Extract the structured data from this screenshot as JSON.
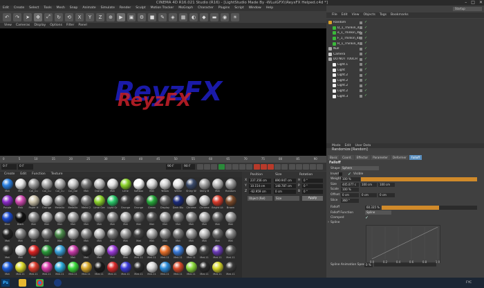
{
  "window": {
    "title": "CINEMA 4D R16.021 Studio (R16) - [LightStudio Made By -WLuiGFX\\\\ReyxFX Helped.c4d *]",
    "controls": [
      "–",
      "□",
      "✕"
    ]
  },
  "main_menu": [
    "Edit",
    "Create",
    "Select",
    "Tools",
    "Mesh",
    "Snap",
    "Animate",
    "Simulate",
    "Render",
    "Sculpt",
    "Motion Tracker",
    "MoGraph",
    "Character",
    "Plugins",
    "Script",
    "Window",
    "Help"
  ],
  "toolbar": {
    "icons": [
      "undo-icon",
      "redo-icon",
      "select-icon",
      "move-icon",
      "scale-icon",
      "rotate-icon",
      "recent-icon",
      "x-axis-icon",
      "y-axis-icon",
      "z-axis-icon",
      "coord-system-icon",
      "render-view-icon",
      "render-picture-icon",
      "render-settings-icon",
      "cube-icon",
      "spline-pen-icon",
      "subdivision-icon",
      "array-icon",
      "sweep-icon",
      "deformer-icon",
      "floor-icon",
      "camera-icon",
      "light-icon"
    ],
    "labels": {
      "x": "X",
      "y": "Y",
      "z": "Z"
    }
  },
  "viewport": {
    "menu": [
      "View",
      "Cameras",
      "Display",
      "Options",
      "Filter",
      "Panel"
    ],
    "logo_text": "ReyzFX",
    "accent_blue": "#1a1aa8",
    "accent_red": "#c8202a"
  },
  "timeline": {
    "ticks": [
      "0",
      "5",
      "10",
      "15",
      "20",
      "25",
      "30",
      "35",
      "40",
      "45",
      "50",
      "55",
      "60",
      "65",
      "70",
      "75",
      "80",
      "85",
      "90"
    ],
    "current_frame": "0 F",
    "start_frame": "0 F",
    "end_frame": "90 F",
    "min_frame": "90 F"
  },
  "material_menu": [
    "Create",
    "Edit",
    "Function",
    "Texture"
  ],
  "materials": [
    {
      "name": "Mat",
      "color": "#2a7fe0"
    },
    {
      "name": "Mat",
      "color": "#e8e8e8"
    },
    {
      "name": "Col_Cu",
      "color": "#9a9a9a"
    },
    {
      "name": "Col_Cu",
      "color": "#a8a8a8"
    },
    {
      "name": "Col_Cu",
      "color": "#b0b0b0"
    },
    {
      "name": "Col_Gol",
      "color": "#c8c8c8"
    },
    {
      "name": "Mat",
      "color": "#777"
    },
    {
      "name": "Orange",
      "color": "#c0c0c0"
    },
    {
      "name": "Mat",
      "color": "#e0e0e0"
    },
    {
      "name": "Lime",
      "color": "#8ad22a"
    },
    {
      "name": "Softbox",
      "color": "#ffffff"
    },
    {
      "name": "Mat",
      "color": "#d8d8d8"
    },
    {
      "name": "Yellow",
      "color": "#cfcfcf"
    },
    {
      "name": "White",
      "color": "#e6e6e6"
    },
    {
      "name": "Shiny W",
      "color": "#3a4a6a"
    },
    {
      "name": "Shiny B",
      "color": "#a0a0a0"
    },
    {
      "name": "Mat",
      "color": "#bbbbbb"
    },
    {
      "name": "Random",
      "color": "#999"
    },
    {
      "name": "Purple",
      "color": "#8a2ac8"
    },
    {
      "name": "Pink",
      "color": "#d04ab0"
    },
    {
      "name": "Paper H",
      "color": "#c9c0a8"
    },
    {
      "name": "Orange",
      "color": "#d8d8d8"
    },
    {
      "name": "Metallic",
      "color": "#888"
    },
    {
      "name": "Metallic",
      "color": "#9a9a9a"
    },
    {
      "name": "Metal 2",
      "color": "#777"
    },
    {
      "name": "Lime Gre",
      "color": "#8ad02a"
    },
    {
      "name": "Light Gr",
      "color": "#2ac86a"
    },
    {
      "name": "Grunge",
      "color": "#444"
    },
    {
      "name": "Grunge",
      "color": "#555"
    },
    {
      "name": "Green",
      "color": "#26a83a"
    },
    {
      "name": "Display",
      "color": "#666"
    },
    {
      "name": "Dark Blu",
      "color": "#1a2a7a"
    },
    {
      "name": "Chrome",
      "color": "#b8b8b8"
    },
    {
      "name": "Chrome",
      "color": "#c4c4c4"
    },
    {
      "name": "Bright Lit",
      "color": "#d83a2a"
    },
    {
      "name": "Brown",
      "color": "#7a4a2a"
    },
    {
      "name": "Blue",
      "color": "#1a4ad0"
    },
    {
      "name": "Black",
      "color": "#111111"
    },
    {
      "name": "Mat",
      "color": "#8a8a8a"
    },
    {
      "name": "Mat",
      "color": "#aaa"
    },
    {
      "name": "Mat",
      "color": "#999"
    },
    {
      "name": "Mat",
      "color": "#a0a0a0"
    },
    {
      "name": "Mat",
      "color": "#888"
    },
    {
      "name": "Mat",
      "color": "#777"
    },
    {
      "name": "Mat",
      "color": "#888"
    },
    {
      "name": "Mat",
      "color": "#aaa"
    },
    {
      "name": "Mat",
      "color": "#666"
    },
    {
      "name": "Mat",
      "color": "#555"
    },
    {
      "name": "Mat",
      "color": "#999"
    },
    {
      "name": "Mat",
      "color": "#777"
    },
    {
      "name": "Mat",
      "color": "#888"
    },
    {
      "name": "Mat",
      "color": "#aaa"
    },
    {
      "name": "Mat",
      "color": "#666"
    },
    {
      "name": "Mat",
      "color": "#999"
    },
    {
      "name": "Mat",
      "color": "#222"
    },
    {
      "name": "Mat",
      "color": "#888"
    },
    {
      "name": "Mat",
      "color": "#999"
    },
    {
      "name": "Mat",
      "color": "#777"
    },
    {
      "name": "Mat",
      "color": "#4a8a4a"
    },
    {
      "name": "Mat",
      "color": "#aaa"
    },
    {
      "name": "Mat",
      "color": "#888"
    },
    {
      "name": "Mat",
      "color": "#bbb"
    },
    {
      "name": "Mat",
      "color": "#777"
    },
    {
      "name": "Mat",
      "color": "#999"
    },
    {
      "name": "Mat",
      "color": "#444"
    },
    {
      "name": "Mat",
      "color": "#aaa"
    },
    {
      "name": "Mat",
      "color": "#888"
    },
    {
      "name": "Mat",
      "color": "#777"
    },
    {
      "name": "Mat",
      "color": "#999"
    },
    {
      "name": "Mat",
      "color": "#bbb"
    },
    {
      "name": "Mat",
      "color": "#666"
    },
    {
      "name": "Mat",
      "color": "#888"
    },
    {
      "name": "Mat",
      "color": "#333"
    },
    {
      "name": "Mat",
      "color": "#e0e0e0"
    },
    {
      "name": "Mat",
      "color": "#d22"
    },
    {
      "name": "Mat",
      "color": "#2a9a3a"
    },
    {
      "name": "Mat",
      "color": "#3aa0d8"
    },
    {
      "name": "Mat",
      "color": "#c83aa8"
    },
    {
      "name": "Mat",
      "color": "#2a2a2a"
    },
    {
      "name": "Mat",
      "color": "#c8c8c8"
    },
    {
      "name": "Mat",
      "color": "#9a3ad8"
    },
    {
      "name": "Mat",
      "color": "#e0e0e0"
    },
    {
      "name": "Mat.11",
      "color": "#eee"
    },
    {
      "name": "Mat.11",
      "color": "#ccc"
    },
    {
      "name": "Mat.11",
      "color": "#e8702a"
    },
    {
      "name": "Mat.11",
      "color": "#3a7ad8"
    },
    {
      "name": "Mat.11",
      "color": "#ddd"
    },
    {
      "name": "Mat.11",
      "color": "#444"
    },
    {
      "name": "Mat.11",
      "color": "#6a3ab8"
    },
    {
      "name": "Mat.11",
      "color": "#555"
    },
    {
      "name": "Mat",
      "color": "#1a5ad8"
    },
    {
      "name": "Mat.11",
      "color": "#d8d82a"
    },
    {
      "name": "Mat.11",
      "color": "#d83a2a"
    },
    {
      "name": "Mat.11",
      "color": "#d83aa8"
    },
    {
      "name": "Mat.11",
      "color": "#2aa8d8"
    },
    {
      "name": "Mat.11",
      "color": "#3ad83a"
    },
    {
      "name": "Mat.11",
      "color": "#d8a82a"
    },
    {
      "name": "Mat.11",
      "color": "#1a1a1a"
    },
    {
      "name": "Mat.11",
      "color": "#d82a2a"
    },
    {
      "name": "Mat.11",
      "color": "#3a3ad8"
    },
    {
      "name": "Mat.11",
      "color": "#2a2a2a"
    },
    {
      "name": "Mat.11",
      "color": "#d8d8d8"
    },
    {
      "name": "Mat.11",
      "color": "#2a8ad8"
    },
    {
      "name": "Mat.11",
      "color": "#d84a2a"
    },
    {
      "name": "Mat.11",
      "color": "#8ad83a"
    },
    {
      "name": "Mat.11",
      "color": "#2a2a2a"
    },
    {
      "name": "Mat.11",
      "color": "#d8d82a"
    },
    {
      "name": "Mat.11",
      "color": "#3a3a3a"
    }
  ],
  "coords": {
    "headers": {
      "position": "Position",
      "size": "Size",
      "rotation": "Rotation"
    },
    "rows": [
      {
        "axis": "X",
        "position": "237.356 cm",
        "size": "890.947 cm",
        "rot_axis": "H",
        "rotation": "0 °"
      },
      {
        "axis": "Y",
        "position": "10.154 cm",
        "size": "148.787 cm",
        "rot_axis": "P",
        "rotation": "0 °"
      },
      {
        "axis": "Z",
        "position": "-62.959 cm",
        "size": "0 cm",
        "rot_axis": "B",
        "rotation": "0 °"
      }
    ],
    "mode": "Object (Rel)",
    "size_mode": "Size",
    "apply": "Apply"
  },
  "right_panel": {
    "layout_label": "Startup",
    "object_menu": [
      "File",
      "Edit",
      "View",
      "Objects",
      "Tags",
      "Bookmarks"
    ],
    "objects": [
      {
        "name": "Random",
        "indent": 0,
        "color": "#d8a02a"
      },
      {
        "name": "D_1_Thinkin_4D",
        "indent": 1,
        "color": "#3ab83a"
      },
      {
        "name": "e_1_Thinkin_4D",
        "indent": 1,
        "color": "#3ab83a"
      },
      {
        "name": "F_1_Thinkin_4D",
        "indent": 1,
        "color": "#3ab83a"
      },
      {
        "name": "H_1_Thinkin_4D",
        "indent": 1,
        "color": "#3ab83a"
      },
      {
        "name": "Null",
        "indent": 0,
        "color": "#aaa"
      },
      {
        "name": "Camera",
        "indent": 0,
        "color": "#ccc"
      },
      {
        "name": "DO NOT TOUCH",
        "indent": 0,
        "color": "#aaa"
      },
      {
        "name": "Light.1",
        "indent": 1,
        "color": "#eee"
      },
      {
        "name": "Light",
        "indent": 1,
        "color": "#eee"
      },
      {
        "name": "Light.2",
        "indent": 1,
        "color": "#eee"
      },
      {
        "name": "Light.2",
        "indent": 1,
        "color": "#eee"
      },
      {
        "name": "Light.2",
        "indent": 1,
        "color": "#eee"
      },
      {
        "name": "Light.2",
        "indent": 1,
        "color": "#eee"
      },
      {
        "name": "Light.3",
        "indent": 1,
        "color": "#eee"
      }
    ],
    "attr_menu": [
      "Mode",
      "Edit",
      "User Data"
    ],
    "attr_title": "Randomize [Random]",
    "tabs": [
      "Basic",
      "Coord.",
      "Effector",
      "Parameter",
      "Deformer",
      "Falloff"
    ],
    "active_tab": "Falloff",
    "falloff": {
      "section": "Falloff",
      "shape_label": "Shape",
      "shape_value": "Sphere",
      "invert_label": "Invert",
      "visible_label": "Visible",
      "weight_label": "Weight",
      "weight_value": "100 %",
      "size_label": "Size",
      "size_x": "445.077 c",
      "size_y": "100 cm",
      "size_z": "100 cm",
      "scale_label": "Scale",
      "scale_value": "100 %",
      "offset_label": "Offset",
      "offset_x": "0 cm",
      "offset_y": "0 cm",
      "offset_z": "0 cm",
      "slice_label": "Slice",
      "slice_value": "360 °",
      "falloff_label": "Falloff",
      "falloff_value": "60.335 %",
      "falloff_fill": 0.603,
      "function_label": "Falloff Function",
      "function_value": "Spline",
      "clamped_label": "Clamped",
      "spline_label": "Spline",
      "sas_label": "Spline Animation Speed",
      "sas_value": "0 %",
      "graph_ticks": [
        "0.0",
        "0.2",
        "0.4",
        "0.6",
        "0.8",
        "1.0"
      ]
    }
  },
  "taskbar": {
    "apps": [
      "ps-icon",
      "explorer-icon",
      "chrome-icon",
      "c4d-icon"
    ],
    "ps_label": "Ps",
    "tray_lang": "FYC"
  }
}
